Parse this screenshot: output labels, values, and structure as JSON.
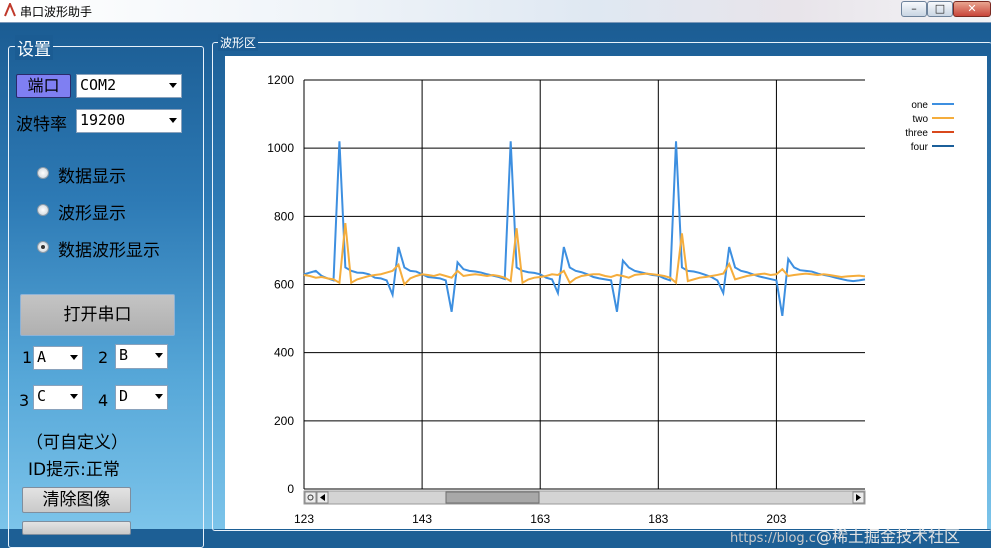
{
  "window": {
    "title": "串口波形助手",
    "minimize": "–",
    "maximize": "□",
    "close": "✕"
  },
  "settings": {
    "group_label": "设置",
    "port_label": "端口",
    "port_value": "COM2",
    "baud_label": "波特率",
    "baud_value": "19200",
    "modes": [
      {
        "label": "数据显示",
        "selected": false
      },
      {
        "label": "波形显示",
        "selected": false
      },
      {
        "label": "数据波形显示",
        "selected": true
      }
    ],
    "open_button": "打开串口",
    "channels": [
      {
        "num": "1",
        "value": "A"
      },
      {
        "num": "2",
        "value": "B"
      },
      {
        "num": "3",
        "value": "C"
      },
      {
        "num": "4",
        "value": "D"
      }
    ],
    "custom_note": "（可自定义）",
    "id_status": "ID提示:正常",
    "clear_button": "清除图像"
  },
  "waveform": {
    "group_label": "波形区"
  },
  "watermark": {
    "text": "https://blog.c",
    "brand": "@稀土掘金技术社区"
  },
  "chart_data": {
    "type": "line",
    "ylim": [
      0,
      1200
    ],
    "yticks": [
      "0",
      "200",
      "400",
      "600",
      "800",
      "1000",
      "1200"
    ],
    "xlim": [
      123,
      218
    ],
    "xticks": [
      "123",
      "143",
      "163",
      "183",
      "203"
    ],
    "grid": true,
    "legend_position": "top-right",
    "series": [
      {
        "name": "one",
        "color": "#3d8fe0",
        "x": [
          123,
          124,
          125,
          126,
          127,
          128,
          129,
          130,
          131,
          132,
          133,
          134,
          135,
          136,
          137,
          138,
          139,
          140,
          141,
          142,
          143,
          144,
          145,
          146,
          147,
          148,
          149,
          150,
          151,
          152,
          153,
          154,
          155,
          156,
          157,
          158,
          159,
          160,
          161,
          162,
          163,
          164,
          165,
          166,
          167,
          168,
          169,
          170,
          171,
          172,
          173,
          174,
          175,
          176,
          177,
          178,
          179,
          180,
          181,
          182,
          183,
          184,
          185,
          186,
          187,
          188,
          189,
          190,
          191,
          192,
          193,
          194,
          195,
          196,
          197,
          198,
          199,
          200,
          201,
          202,
          203,
          204,
          205,
          206,
          207,
          208,
          209,
          210,
          211,
          212,
          213,
          214,
          215,
          216,
          217,
          218
        ],
        "values": [
          630,
          635,
          640,
          625,
          618,
          612,
          1020,
          650,
          640,
          635,
          634,
          630,
          620,
          618,
          612,
          570,
          710,
          650,
          640,
          638,
          630,
          622,
          620,
          618,
          612,
          520,
          665,
          645,
          640,
          638,
          635,
          630,
          626,
          622,
          616,
          1020,
          650,
          640,
          636,
          634,
          630,
          620,
          615,
          575,
          710,
          650,
          640,
          636,
          630,
          622,
          618,
          615,
          612,
          520,
          670,
          650,
          640,
          636,
          632,
          628,
          626,
          618,
          612,
          1020,
          650,
          640,
          638,
          634,
          628,
          622,
          612,
          575,
          710,
          650,
          640,
          636,
          630,
          624,
          620,
          616,
          612,
          508,
          675,
          650,
          642,
          640,
          638,
          632,
          628,
          625,
          620,
          616,
          612,
          610,
          612,
          615
        ]
      },
      {
        "name": "two",
        "color": "#f5ad3c",
        "x": [
          123,
          124,
          125,
          126,
          127,
          128,
          129,
          130,
          131,
          132,
          133,
          134,
          135,
          136,
          137,
          138,
          139,
          140,
          141,
          142,
          143,
          144,
          145,
          146,
          147,
          148,
          149,
          150,
          151,
          152,
          153,
          154,
          155,
          156,
          157,
          158,
          159,
          160,
          161,
          162,
          163,
          164,
          165,
          166,
          167,
          168,
          169,
          170,
          171,
          172,
          173,
          174,
          175,
          176,
          177,
          178,
          179,
          180,
          181,
          182,
          183,
          184,
          185,
          186,
          187,
          188,
          189,
          190,
          191,
          192,
          193,
          194,
          195,
          196,
          197,
          198,
          199,
          200,
          201,
          202,
          203,
          204,
          205,
          206,
          207,
          208,
          209,
          210,
          211,
          212,
          213,
          214,
          215,
          216,
          217,
          218
        ],
        "values": [
          628,
          625,
          620,
          622,
          618,
          615,
          605,
          780,
          605,
          615,
          620,
          625,
          628,
          630,
          635,
          640,
          658,
          600,
          618,
          625,
          630,
          628,
          625,
          630,
          625,
          620,
          640,
          625,
          628,
          630,
          628,
          625,
          628,
          625,
          620,
          610,
          765,
          605,
          615,
          620,
          622,
          625,
          630,
          628,
          640,
          605,
          618,
          625,
          628,
          630,
          630,
          625,
          622,
          628,
          625,
          620,
          628,
          630,
          632,
          630,
          628,
          625,
          620,
          605,
          750,
          610,
          615,
          620,
          622,
          625,
          628,
          632,
          660,
          615,
          620,
          625,
          628,
          630,
          632,
          628,
          630,
          645,
          625,
          628,
          630,
          632,
          630,
          628,
          630,
          628,
          625,
          622,
          624,
          625,
          626,
          624
        ]
      },
      {
        "name": "three",
        "color": "#d9481c",
        "x": [],
        "values": []
      },
      {
        "name": "four",
        "color": "#1b5f9a",
        "x": [],
        "values": []
      }
    ]
  }
}
